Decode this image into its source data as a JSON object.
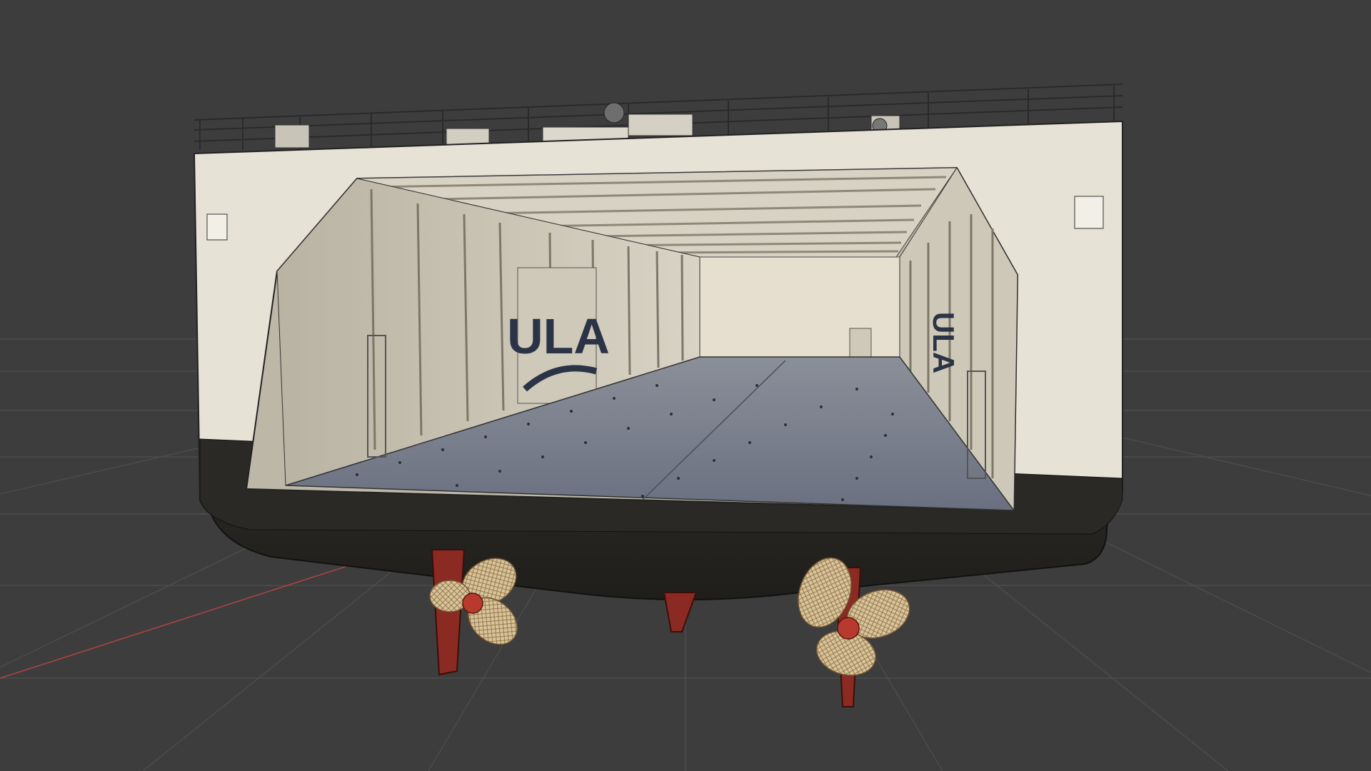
{
  "viewport": {
    "background": "#3d3d3d",
    "grid_color": "#555555",
    "x_axis_color": "#c84848"
  },
  "model": {
    "logo_text": "ULA",
    "logo_color": "#2b3347",
    "hull_color": "#e8e3d8",
    "hull_shadow": "#2b2a26",
    "deck_color": "#6b7180",
    "interior_wall": "#d7d1c2",
    "rudder_color": "#8a2a22",
    "propeller_color": "#d8c4a0"
  }
}
